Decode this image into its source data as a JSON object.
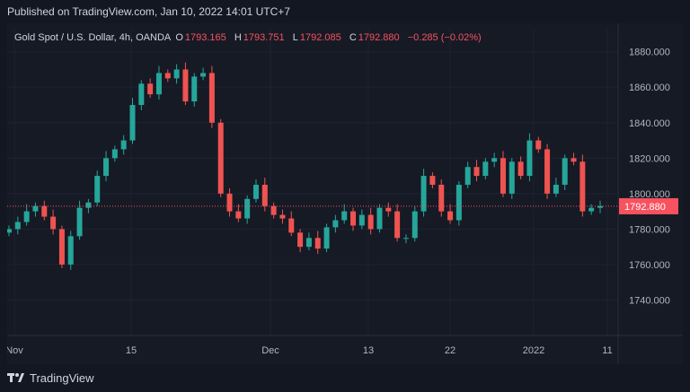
{
  "header": {
    "published": "Published on TradingView.com, Jan 10, 2022 14:01 UTC+7"
  },
  "legend": {
    "symbol": "Gold Spot / U.S. Dollar, 4h, OANDA",
    "open_label": "O",
    "open": "1793.165",
    "high_label": "H",
    "high": "1793.751",
    "low_label": "L",
    "low": "1792.085",
    "close_label": "C",
    "close": "1792.880",
    "change": "−0.285 (−0.02%)"
  },
  "footer": {
    "brand": "TradingView",
    "logo_icon": "tradingview-logo-icon"
  },
  "colors": {
    "up": "#26a69a",
    "down": "#ef5350",
    "background": "#131722",
    "grid": "#1f2330",
    "price_tag": "#f7525f"
  },
  "chart_data": {
    "type": "candlestick",
    "instrument": "Gold Spot / U.S. Dollar",
    "interval": "4h",
    "source": "OANDA",
    "ylim": [
      1720,
      1893
    ],
    "y_ticks": [
      "1880.000",
      "1860.000",
      "1840.000",
      "1820.000",
      "1800.000",
      "1780.000",
      "1760.000",
      "1740.000"
    ],
    "x_ticks": [
      "Nov",
      "15",
      "Dec",
      "13",
      "22",
      "2022",
      "11"
    ],
    "last_price": "1792.880",
    "series": [
      {
        "name": "close",
        "values": [
          1780,
          1784,
          1790,
          1793,
          1787,
          1780,
          1760,
          1776,
          1792,
          1795,
          1810,
          1820,
          1825,
          1830,
          1850,
          1862,
          1856,
          1868,
          1865,
          1870,
          1852,
          1866,
          1868,
          1840,
          1800,
          1790,
          1786,
          1797,
          1805,
          1793,
          1788,
          1786,
          1778,
          1770,
          1775,
          1769,
          1781,
          1785,
          1790,
          1782,
          1788,
          1780,
          1792,
          1790,
          1775,
          1775,
          1790,
          1810,
          1805,
          1790,
          1785,
          1805,
          1815,
          1810,
          1818,
          1820,
          1800,
          1818,
          1810,
          1830,
          1825,
          1800,
          1805,
          1820,
          1818,
          1790,
          1792,
          1793
        ]
      },
      {
        "name": "range_note",
        "values": []
      }
    ]
  }
}
